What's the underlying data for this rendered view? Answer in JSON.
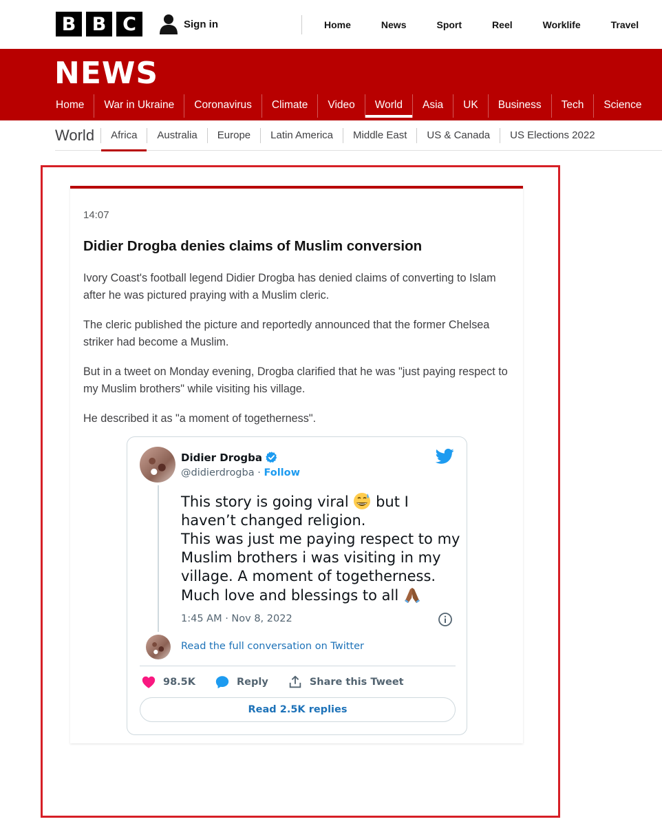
{
  "topbar": {
    "logo": [
      "B",
      "B",
      "C"
    ],
    "signin_label": "Sign in",
    "nav": [
      "Home",
      "News",
      "Sport",
      "Reel",
      "Worklife",
      "Travel"
    ]
  },
  "newsbar": {
    "title": "NEWS",
    "nav": [
      "Home",
      "War in Ukraine",
      "Coronavirus",
      "Climate",
      "Video",
      "World",
      "Asia",
      "UK",
      "Business",
      "Tech",
      "Science"
    ],
    "active": "World"
  },
  "worldbar": {
    "label": "World",
    "nav": [
      "Africa",
      "Australia",
      "Europe",
      "Latin America",
      "Middle East",
      "US & Canada",
      "US Elections 2022"
    ],
    "active": "Africa"
  },
  "article": {
    "time": "14:07",
    "headline": "Didier Drogba denies claims of Muslim conversion",
    "paragraphs": [
      "Ivory Coast's football legend Didier Drogba has denied claims of converting to Islam after he was pictured praying with a Muslim cleric.",
      "The cleric published the picture and reportedly announced that the former Chelsea striker had become a Muslim.",
      "But in a tweet on Monday evening, Drogba clarified that he was \"just paying respect to my Muslim brothers\" while visiting his village.",
      "He described it as \"a moment of togetherness\"."
    ]
  },
  "tweet": {
    "author": "Didier Drogba",
    "handle": "@didierdrogba",
    "separator": " · ",
    "follow_label": "Follow",
    "text_line1_a": "This story is going viral ",
    "text_line1_b": " but I haven’t changed religion.",
    "text_line2": "This was just me paying respect to my Muslim brothers i was visiting in my village. A moment of togetherness.",
    "text_line3": "Much love and blessings to all ",
    "date": "1:45 AM · Nov 8, 2022",
    "read_full": "Read the full conversation on Twitter",
    "likes": "98.5K",
    "reply_label": "Reply",
    "share_label": "Share this Tweet",
    "replies_button": "Read 2.5K replies",
    "colors": {
      "link": "#1d9bf0",
      "heart": "#f91880"
    }
  }
}
